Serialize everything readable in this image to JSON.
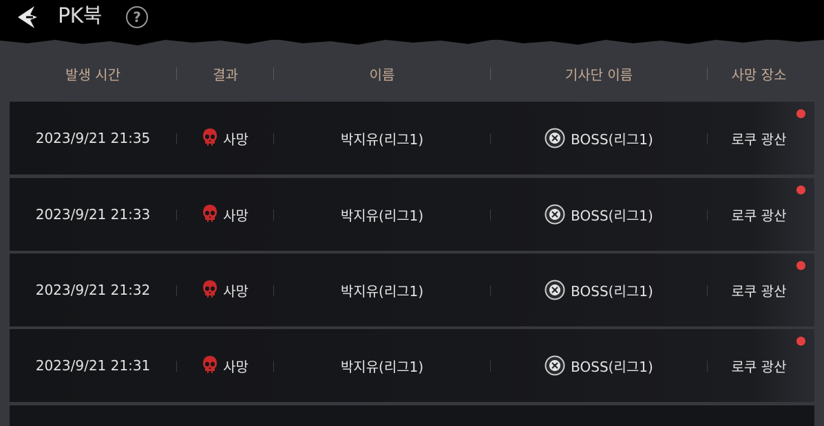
{
  "header": {
    "title": "PK북",
    "help_label": "?"
  },
  "table": {
    "columns": [
      "발생 시간",
      "결과",
      "이름",
      "기사단 이름",
      "사망 장소"
    ],
    "rows": [
      {
        "time": "2023/9/21 21:35",
        "result": "사망",
        "name": "박지유(리그1)",
        "guild": "BOSS(리그1)",
        "place": "로쿠 광산",
        "new": true
      },
      {
        "time": "2023/9/21 21:33",
        "result": "사망",
        "name": "박지유(리그1)",
        "guild": "BOSS(리그1)",
        "place": "로쿠 광산",
        "new": true
      },
      {
        "time": "2023/9/21 21:32",
        "result": "사망",
        "name": "박지유(리그1)",
        "guild": "BOSS(리그1)",
        "place": "로쿠 광산",
        "new": true
      },
      {
        "time": "2023/9/21 21:31",
        "result": "사망",
        "name": "박지유(리그1)",
        "guild": "BOSS(리그1)",
        "place": "로쿠 광산",
        "new": true
      }
    ]
  },
  "icons": {
    "back": "back-arrow-icon",
    "help": "question-circle-icon",
    "result": "skull-icon",
    "guild": "guild-emblem-icon",
    "unread": "red-dot-icon"
  },
  "colors": {
    "header_text": "#c3aa95",
    "skull": "#c8282a",
    "unread_dot": "#e2403f",
    "row_bg": "#141518",
    "page_bg": "#37383d"
  }
}
